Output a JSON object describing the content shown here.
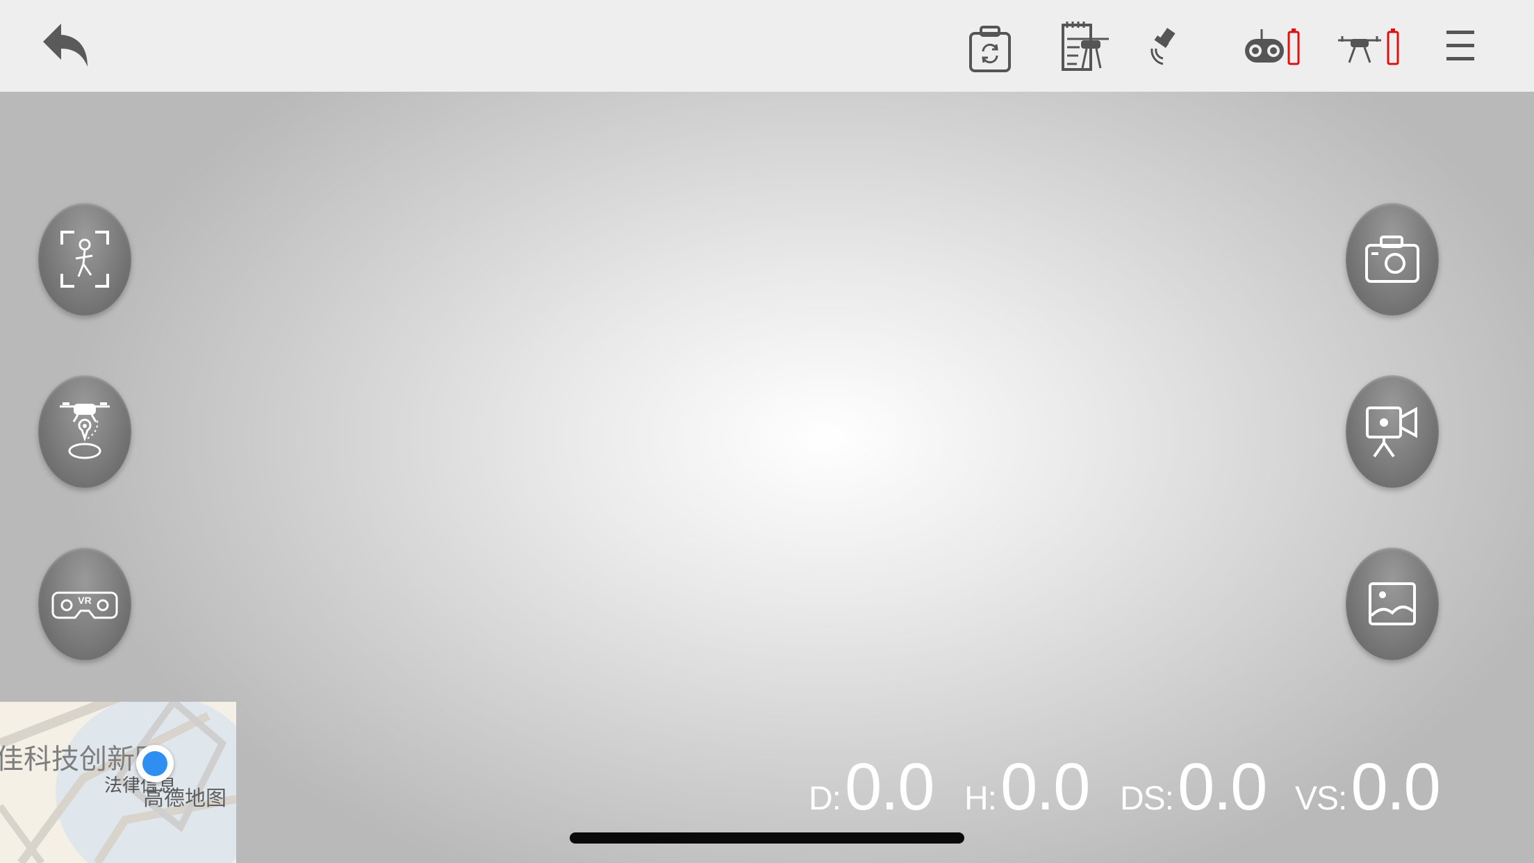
{
  "icons": {
    "back": "back-arrow-icon",
    "camera_switch": "camera-switch-icon",
    "flight_log": "flight-log-drone-icon",
    "gps": "satellite-gps-icon",
    "controller": "remote-controller-icon",
    "drone_battery": "drone-battery-icon",
    "menu": "hamburger-menu-icon",
    "follow_me": "follow-me-person-icon",
    "waypoint": "drone-waypoint-icon",
    "vr": "vr-headset-icon",
    "photo": "camera-photo-icon",
    "video": "video-record-icon",
    "gallery": "gallery-image-icon"
  },
  "colors": {
    "battery_low": "#e01010",
    "icon_gray": "#555555",
    "map_blue": "#2e8ff0"
  },
  "vr_label": "VR",
  "map": {
    "area_name": "佳科技创新园",
    "poi_label": "法律信息",
    "provider": "高德地图"
  },
  "telemetry": {
    "distance_label": "D:",
    "distance_value": "0.0",
    "height_label": "H:",
    "height_value": "0.0",
    "horizontal_speed_label": "DS:",
    "horizontal_speed_value": "0.0",
    "vertical_speed_label": "VS:",
    "vertical_speed_value": "0.0"
  }
}
